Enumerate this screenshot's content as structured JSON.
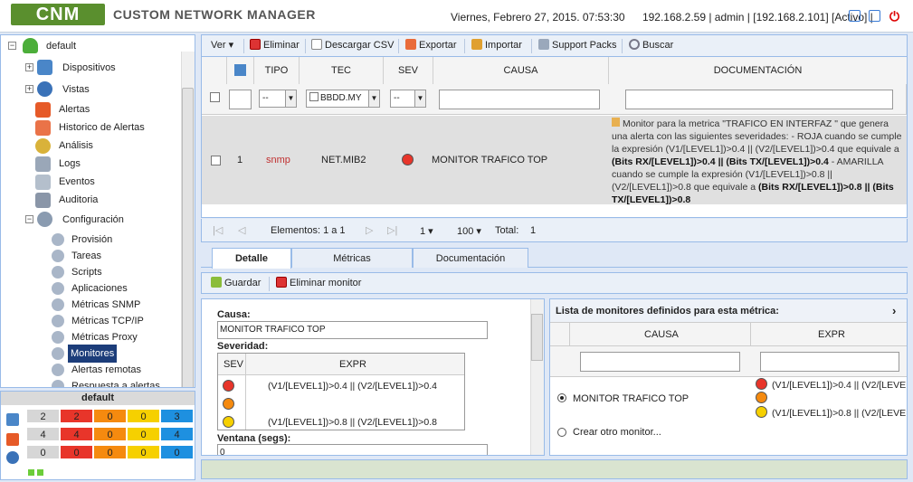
{
  "header": {
    "brand": "CUSTOM NETWORK MANAGER",
    "logo": "CNM",
    "date": "Viernes, Febrero 27, 2015. 07:53:30",
    "session": "192.168.2.59 | admin | [192.168.2.101] [Activo] |"
  },
  "tree": {
    "root": "default",
    "items": [
      {
        "label": "Dispositivos",
        "icon": "devices-icon"
      },
      {
        "label": "Vistas",
        "icon": "views-icon"
      },
      {
        "label": "Alertas",
        "icon": "alerts-icon"
      },
      {
        "label": "Historico de Alertas",
        "icon": "alert-history-icon"
      },
      {
        "label": "Análisis",
        "icon": "analysis-icon"
      },
      {
        "label": "Logs",
        "icon": "logs-icon"
      },
      {
        "label": "Eventos",
        "icon": "events-icon"
      },
      {
        "label": "Auditoria",
        "icon": "audit-icon"
      },
      {
        "label": "Configuración",
        "icon": "config-icon"
      }
    ],
    "config_items": [
      "Provisión",
      "Tareas",
      "Scripts",
      "Aplicaciones",
      "Métricas SNMP",
      "Métricas TCP/IP",
      "Métricas Proxy",
      "Monitores",
      "Alertas remotas",
      "Respuesta a alertas"
    ]
  },
  "summary": {
    "title": "default",
    "rows": [
      [
        "2",
        "2",
        "0",
        "0",
        "3"
      ],
      [
        "4",
        "4",
        "0",
        "0",
        "4"
      ],
      [
        "0",
        "0",
        "0",
        "0",
        "0"
      ]
    ]
  },
  "toolbar": {
    "ver": "Ver",
    "eliminar": "Eliminar",
    "csv": "Descargar CSV",
    "exportar": "Exportar",
    "importar": "Importar",
    "support": "Support Packs",
    "buscar": "Buscar"
  },
  "grid": {
    "columns": [
      "TIPO",
      "TEC",
      "SEV",
      "CAUSA",
      "DOCUMENTACIÓN"
    ],
    "filters": {
      "tipo": "--",
      "tec": "BBDD.MY",
      "sev": "--"
    },
    "row": {
      "num": "1",
      "tipo": "snmp",
      "tec": "NET.MIB2",
      "causa": "MONITOR TRAFICO TOP",
      "doc1": "Monitor para la metrica \"TRAFICO EN INTERFAZ \" que genera una alerta con las siguientes severidades: - ROJA cuando se cumple la expresión (V1/[LEVEL1])>0.4 || (V2/[LEVEL1])>0.4 que equivale a ",
      "doc2": "(Bits RX/[LEVEL1])>0.4 || (Bits TX/[LEVEL1])>0.4",
      "doc3": " - AMARILLA cuando se cumple la expresión (V1/[LEVEL1])>0.8 || (V2/[LEVEL1])>0.8 que equivale a ",
      "doc4": "(Bits RX/[LEVEL1])>0.8 || (Bits TX/[LEVEL1])>0.8"
    }
  },
  "pager": {
    "elementos": "Elementos: 1 a 1",
    "page": "1",
    "size": "100",
    "total": "Total:",
    "total_val": "1"
  },
  "tabs": [
    "Detalle",
    "Métricas",
    "Documentación"
  ],
  "tb2": {
    "guardar": "Guardar",
    "eliminar": "Eliminar monitor"
  },
  "form": {
    "causa_label": "Causa:",
    "causa_value": "MONITOR TRAFICO TOP",
    "sev_label": "Severidad:",
    "sev_col": "SEV",
    "expr_col": "EXPR",
    "expr_red": "(V1/[LEVEL1])>0.4 || (V2/[LEVEL1])>0.4",
    "expr_yellow": "(V1/[LEVEL1])>0.8 || (V2/[LEVEL1])>0.8",
    "ventana_label": "Ventana (segs):",
    "ventana_value": "0"
  },
  "right_panel": {
    "title": "Lista de monitores definidos para esta métrica:",
    "col_causa": "CAUSA",
    "col_expr": "EXPR",
    "monitor": "MONITOR TRAFICO TOP",
    "expr1": "(V1/[LEVEL1])>0.4 || (V2/[LEVE",
    "expr3": "(V1/[LEVEL1])>0.8 || (V2/[LEVE",
    "create": "Crear otro monitor..."
  },
  "colors": {
    "red": "#e8352a",
    "orange": "#f58a0f",
    "yellow": "#f6d000",
    "blue": "#1e90e0",
    "gray": "#d6d6d6",
    "green": "#3bb34a"
  }
}
